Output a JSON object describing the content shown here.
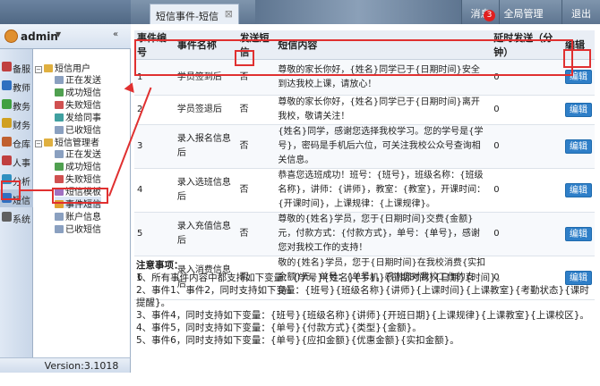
{
  "header": {
    "tab_title": "短信事件-短信",
    "tab_close": "⊠",
    "btn_messages": "消息",
    "badge_count": "3",
    "btn_global": "全局管理",
    "btn_exit": "退出"
  },
  "user": {
    "name": "admin",
    "caret": "▼"
  },
  "nav": [
    {
      "label": "备服",
      "color": "#c04040"
    },
    {
      "label": "教师",
      "color": "#3070c0"
    },
    {
      "label": "教务",
      "color": "#40a040"
    },
    {
      "label": "财务",
      "color": "#d0a020"
    },
    {
      "label": "仓库",
      "color": "#c06030"
    },
    {
      "label": "人事",
      "color": "#c04040"
    },
    {
      "label": "分析",
      "color": "#3090c0"
    },
    {
      "label": "短信",
      "color": "#3070c0"
    },
    {
      "label": "系统",
      "color": "#606060"
    }
  ],
  "tree": {
    "group1": "短信用户",
    "g1_items": [
      "正在发送",
      "成功短信",
      "失败短信",
      "发给同事",
      "已收短信"
    ],
    "group2": "短信管理者",
    "g2_items": [
      "正在发送",
      "成功短信",
      "失败短信",
      "短信模板",
      "事件短信",
      "账户信息",
      "已收短信"
    ]
  },
  "version": "Version:3.1018",
  "table": {
    "headers": [
      "事件编号",
      "事件名称",
      "发送短信",
      "短信内容",
      "延时发送（分钟）",
      "编辑"
    ],
    "rows": [
      {
        "id": "1",
        "name": "学员签到后",
        "send": "否",
        "content": "尊敬的家长你好，{姓名}同学已于{日期时间}安全到达我校上课，请放心！",
        "delay": "0",
        "edit": "编辑"
      },
      {
        "id": "2",
        "name": "学员签退后",
        "send": "否",
        "content": "尊敬的家长你好，{姓名}同学已于{日期时间}离开我校，敬请关注！",
        "delay": "0",
        "edit": "编辑"
      },
      {
        "id": "3",
        "name": "录入报名信息后",
        "send": "否",
        "content": "{姓名}同学，感谢您选择我校学习。您的学号是{学号}，密码是手机后六位，可关注我校公众号查询相关信息。",
        "delay": "0",
        "edit": "编辑"
      },
      {
        "id": "4",
        "name": "录入选班信息后",
        "send": "否",
        "content": "恭喜您选班成功！班号：{班号}，班级名称：{班级名称}，讲师：{讲师}，教室：{教室}，开课时间：{开课时间}，上课规律：{上课规律}。",
        "delay": "0",
        "edit": "编辑"
      },
      {
        "id": "5",
        "name": "录入充值信息后",
        "send": "否",
        "content": "尊敬的{姓名}学员，您于{日期时间}交费{金额}元，付款方式：{付款方式}，单号：{单号}，感谢您对我校工作的支持！",
        "delay": "0",
        "edit": "编辑"
      },
      {
        "id": "6",
        "name": "录入消费信息后",
        "send": "否",
        "content": "敬的{姓名}学员，您于{日期时间}在我校消费{实扣金额}元，单号：{单号}，感谢您对我校工作的支持！",
        "delay": "0",
        "edit": "编辑"
      }
    ]
  },
  "notes": {
    "title": "注意事项：",
    "lines": [
      "1、所有事件内容中都支持如下变量：{学号}{姓名}{手机}{日期时间}{日期}{时间}。",
      "2、事件1、事件2，同时支持如下变量：{班号}{班级名称}{讲师}{上课时间}{上课教室}{考勤状态}{课时提醒}。",
      "3、事件4，同时支持如下变量：{班号}{班级名称}{讲师}{开班日期}{上课规律}{上课教室}{上课校区}。",
      "4、事件5，同时支持如下变量：{单号}{付款方式}{类型}{金额}。",
      "5、事件6，同时支持如下变量：{单号}{应扣金额}{优惠金额}{实扣金额}。"
    ]
  }
}
